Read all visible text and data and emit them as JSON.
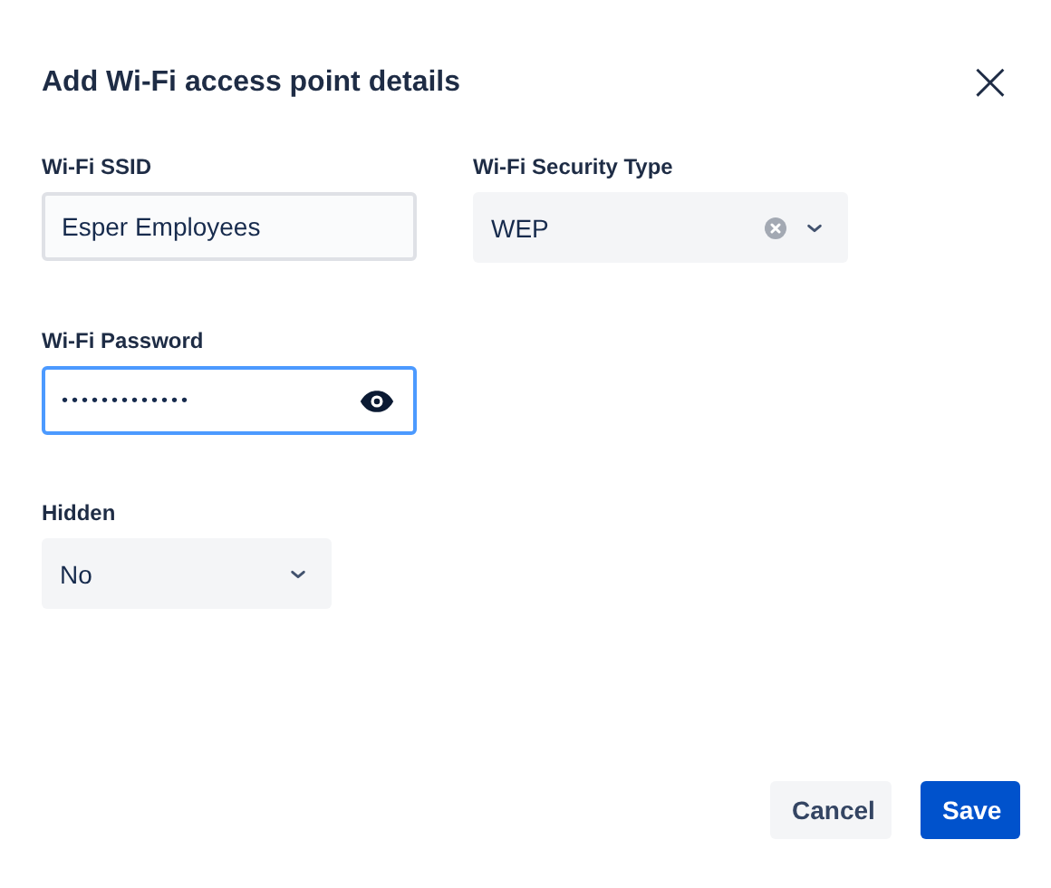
{
  "dialog": {
    "title": "Add Wi-Fi access point details",
    "close": "×"
  },
  "fields": [
    {
      "kind": "text",
      "label": "Wi-Fi SSID",
      "value": "Esper Employees",
      "focused": false
    },
    {
      "kind": "select",
      "label": "Wi-Fi Security Type",
      "value": "WEP",
      "clearable": true
    },
    {
      "kind": "password",
      "label": "Wi-Fi Password",
      "value": "•••••••••••••",
      "focused": true
    },
    {
      "kind": "spacer"
    },
    {
      "kind": "select",
      "label": "Hidden",
      "value": "No",
      "clearable": false,
      "narrow": true
    }
  ],
  "buttons": [
    {
      "label": "Cancel",
      "kind": "secondary"
    },
    {
      "label": "Save",
      "kind": "primary"
    }
  ]
}
